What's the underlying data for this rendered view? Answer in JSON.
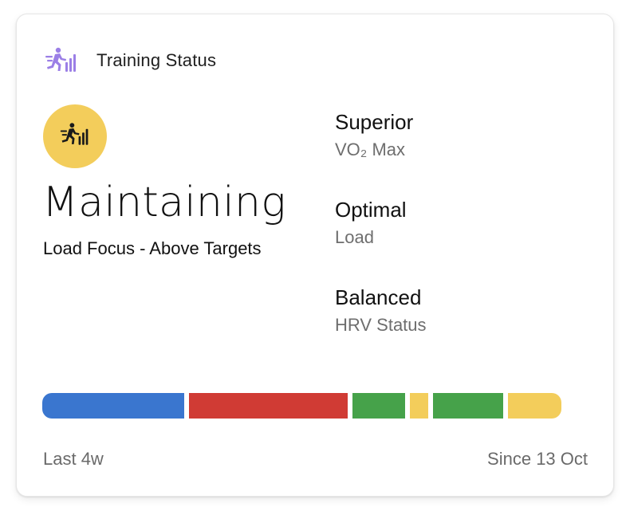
{
  "card": {
    "title": "Training Status",
    "header_icon": "training-status-icon",
    "badge_icon": "training-status-icon",
    "badge_color": "#f3cd5b",
    "status": "Maintaining",
    "status_detail": "Load Focus - Above Targets",
    "metrics": [
      {
        "value": "Superior",
        "label": "VO₂ Max"
      },
      {
        "value": "Optimal",
        "label": "Load"
      },
      {
        "value": "Balanced",
        "label": "HRV Status"
      }
    ],
    "history_bar": [
      {
        "color": "#3a76cf",
        "fraction": 0.273
      },
      {
        "color": "#d03b34",
        "fraction": 0.305
      },
      {
        "color": "#46a24a",
        "fraction": 0.101
      },
      {
        "color": "#f3cd5b",
        "fraction": 0.034
      },
      {
        "color": "#46a24a",
        "fraction": 0.135
      },
      {
        "color": "#f3cd5b",
        "fraction": 0.103
      }
    ],
    "footer_left": "Last 4w",
    "footer_right": "Since 13 Oct"
  }
}
